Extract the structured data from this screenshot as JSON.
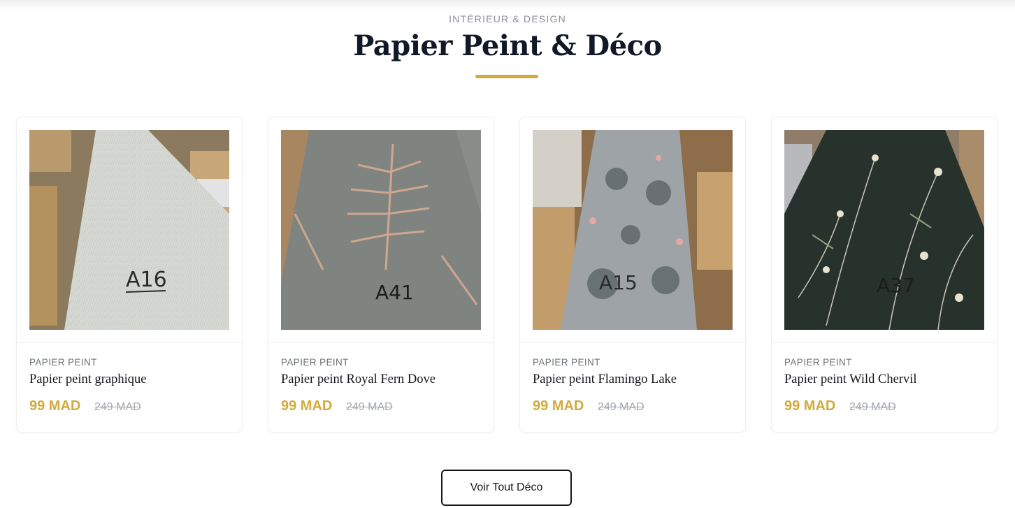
{
  "section": {
    "kicker": "INTÉRIEUR & DESIGN",
    "title": "Papier Peint & Déco",
    "accent_color": "#d2aa3c"
  },
  "products": [
    {
      "category": "PAPIER PEINT",
      "name": "Papier peint graphique",
      "price": "99 MAD",
      "old_price": "249 MAD",
      "image_label": "A16"
    },
    {
      "category": "PAPIER PEINT",
      "name": "Papier peint Royal Fern Dove",
      "price": "99 MAD",
      "old_price": "249 MAD",
      "image_label": "A41"
    },
    {
      "category": "PAPIER PEINT",
      "name": "Papier peint Flamingo Lake",
      "price": "99 MAD",
      "old_price": "249 MAD",
      "image_label": "A15"
    },
    {
      "category": "PAPIER PEINT",
      "name": "Papier peint Wild Chervil",
      "price": "99 MAD",
      "old_price": "249 MAD",
      "image_label": "A37"
    }
  ],
  "cta": {
    "label": "Voir Tout Déco"
  }
}
